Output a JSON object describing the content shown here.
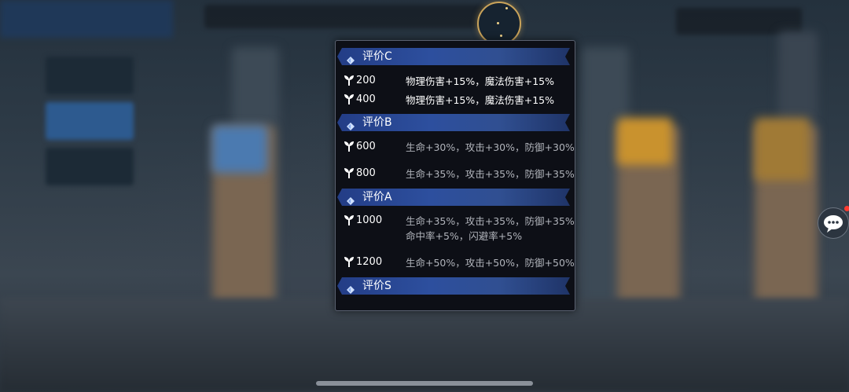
{
  "panel": {
    "tiers": [
      {
        "label": "评价C",
        "rows": [
          {
            "points": "200",
            "lines": [
              "物理伤害+15%，魔法伤害+15%"
            ],
            "style": "bright"
          },
          {
            "points": "400",
            "lines": [
              "物理伤害+15%，魔法伤害+15%"
            ],
            "style": "bright"
          }
        ]
      },
      {
        "label": "评价B",
        "rows": [
          {
            "points": "600",
            "lines": [
              "生命+30%，攻击+30%，防御+30%"
            ],
            "style": "dim"
          },
          {
            "points": "800",
            "lines": [
              "生命+35%，攻击+35%，防御+35%"
            ],
            "style": "dim"
          }
        ]
      },
      {
        "label": "评价A",
        "rows": [
          {
            "points": "1000",
            "lines": [
              "生命+35%，攻击+35%，防御+35%",
              "命中率+5%，闪避率+5%"
            ],
            "style": "dim"
          },
          {
            "points": "1200",
            "lines": [
              "生命+50%，攻击+50%，防御+50%"
            ],
            "style": "dim"
          }
        ]
      },
      {
        "label": "评价S",
        "rows": []
      }
    ]
  },
  "colors": {
    "header_blue": "#2d4f9e",
    "panel_bg": "#0d0f16",
    "orb_gold": "#c9a35a",
    "badge_red": "#ff3b30"
  },
  "icons": {
    "row_icon": "sprout-icon",
    "header_icon": "diamond-gem-icon",
    "chat": "chat-bubble-icon"
  }
}
